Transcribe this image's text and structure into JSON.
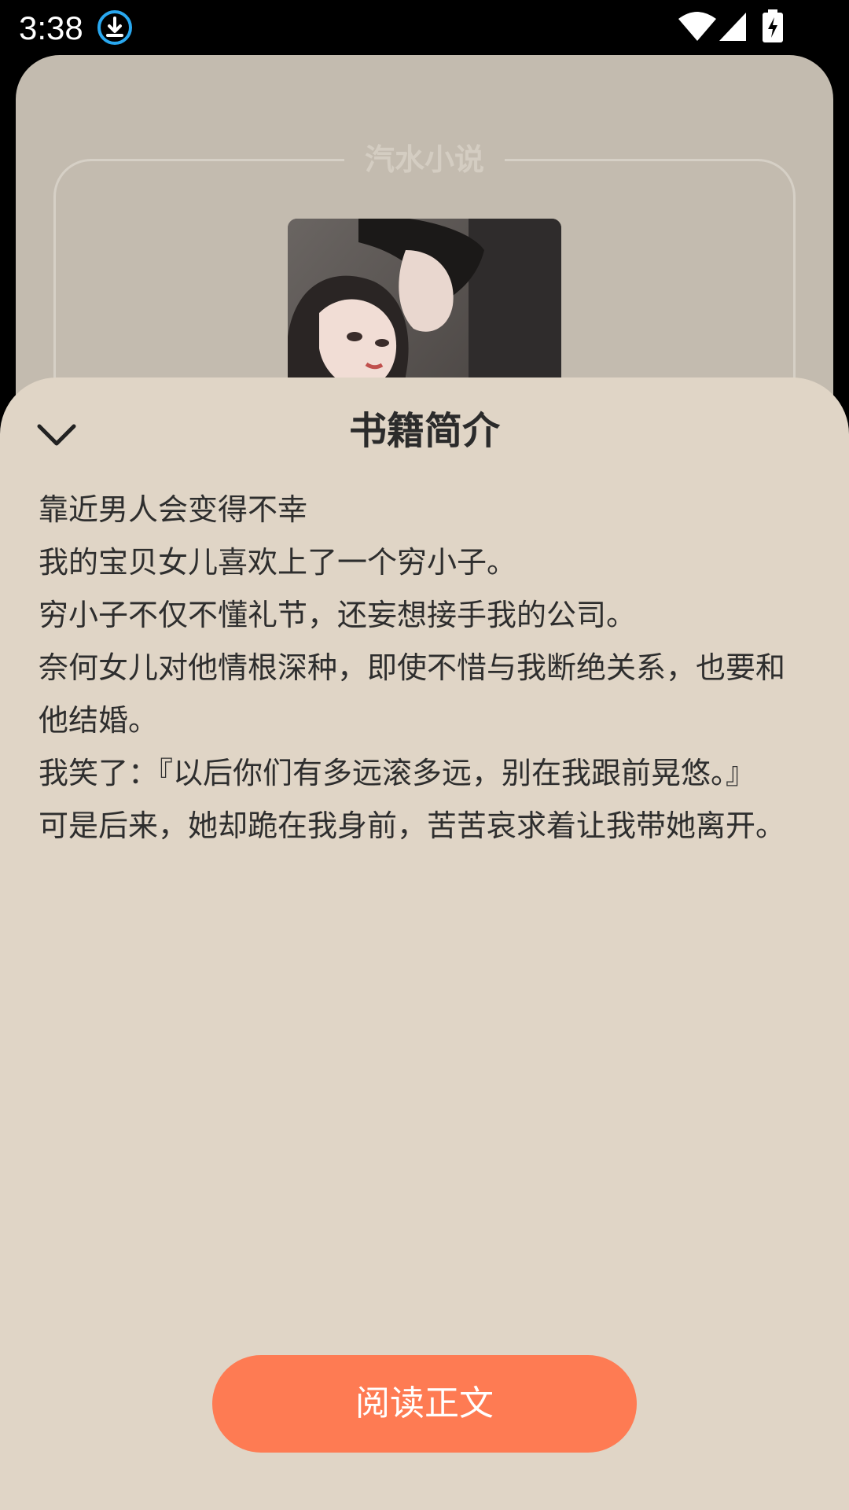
{
  "status_bar": {
    "time": "3:38",
    "icons": [
      "download-icon",
      "wifi-icon",
      "signal-icon",
      "battery-charging-icon"
    ]
  },
  "background_page": {
    "brand": "汽水小说",
    "cover_image": "book-cover-illustration"
  },
  "sheet": {
    "title": "书籍简介",
    "collapse_icon": "chevron-down-icon",
    "synopsis": [
      "靠近男人会变得不幸",
      "我的宝贝女儿喜欢上了一个穷小子。",
      "穷小子不仅不懂礼节，还妄想接手我的公司。",
      "奈何女儿对他情根深种，即使不惜与我断绝关系，也要和他结婚。",
      "我笑了：『以后你们有多远滚多远，别在我跟前晃悠。』",
      "可是后来，她却跪在我身前，苦苦哀求着让我带她离开。"
    ],
    "read_button": "阅读正文"
  },
  "colors": {
    "sheet_background": "#e0d5c6",
    "page_background": "#c3bbaf",
    "accent": "#fe7b53",
    "status_bar": "#000000"
  }
}
